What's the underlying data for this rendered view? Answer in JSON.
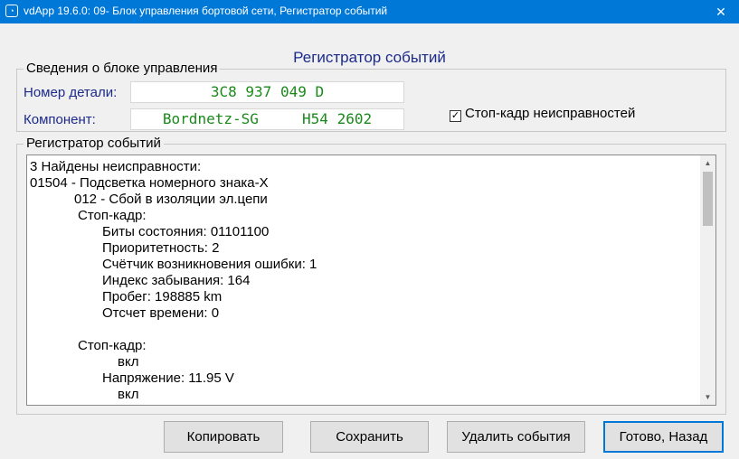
{
  "window": {
    "title": "vdApp 19.6.0: 09- Блок управления бортовой сети,  Регистратор событий",
    "icon": "app-icon",
    "close_glyph": "✕"
  },
  "heading": "Регистратор событий",
  "control_unit": {
    "group_title": "Сведения о блоке управления",
    "part_number_label": "Номер детали:",
    "part_number_value": "3C8 937 049 D",
    "component_label": "Компонент:",
    "component_value": "Bordnetz-SG     H54 2602",
    "freeze_frame_checkbox": {
      "label": "Стоп-кадр неисправностей",
      "checked": true
    }
  },
  "event_log": {
    "group_title": "Регистратор событий",
    "lines": [
      "3 Найдены неисправности:",
      "01504 - Подсветка номерного знака-Х",
      "012 - Сбой в изоляции эл.цепи",
      "Стоп-кадр:",
      "Биты состояния: 01101100",
      "Приоритетность: 2",
      "Счётчик возникновения ошибки: 1",
      "Индекс забывания: 164",
      "Пробег: 198885 km",
      "Отсчет времени: 0",
      "",
      "Стоп-кадр:",
      "вкл",
      "Напряжение: 11.95 V",
      "вкл"
    ]
  },
  "buttons": {
    "copy": "Копировать",
    "save": "Сохранить",
    "delete_events": "Удалить события",
    "done_back": "Готово, Назад"
  },
  "colors": {
    "titlebar": "#0078d7",
    "label_blue": "#1c2a8c",
    "value_green": "#1a8a1a"
  }
}
